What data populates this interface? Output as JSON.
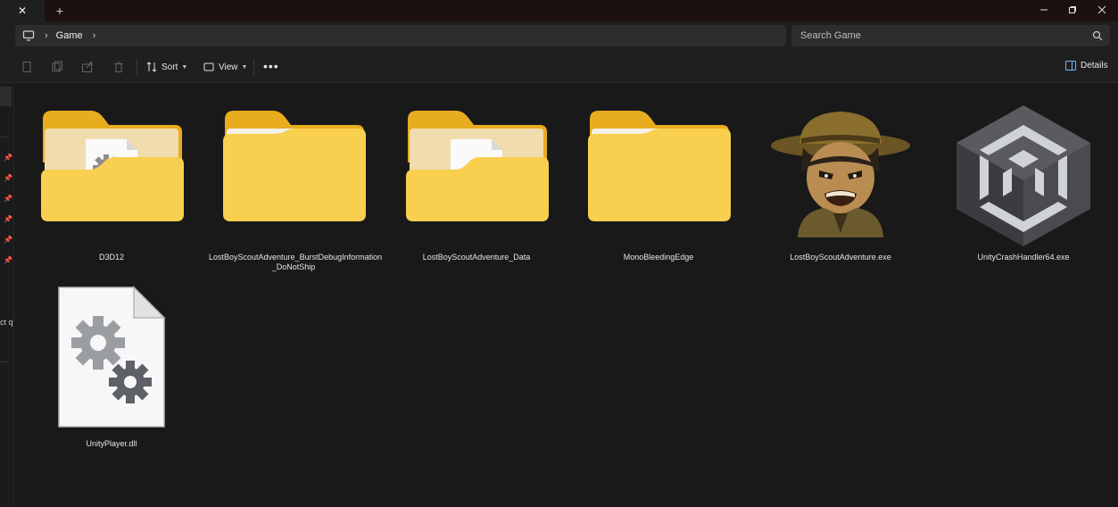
{
  "window": {
    "tab_close_icon": "close-icon",
    "new_tab_icon": "plus-icon",
    "controls": [
      "minimize-icon",
      "restore-icon",
      "close-icon"
    ]
  },
  "address": {
    "crumbs": [
      "Game"
    ],
    "search_placeholder": "Search Game"
  },
  "toolbar": {
    "sort_label": "Sort",
    "view_label": "View",
    "more_label": "•••",
    "details_label": "Details"
  },
  "nav": {
    "truncated_text": "ct q"
  },
  "items": [
    {
      "name": "D3D12",
      "kind": "folder-with-settings-file"
    },
    {
      "name": "LostBoyScoutAdventure_BurstDebugInformation_DoNotShip",
      "line1": "LostBoyScoutAdventure_BurstDebugInformation",
      "line2": "_DoNotShip",
      "kind": "folder"
    },
    {
      "name": "LostBoyScoutAdventure_Data",
      "kind": "folder-with-file"
    },
    {
      "name": "MonoBleedingEdge",
      "kind": "folder"
    },
    {
      "name": "LostBoyScoutAdventure.exe",
      "kind": "scout-app-icon"
    },
    {
      "name": "UnityCrashHandler64.exe",
      "kind": "unity-icon"
    },
    {
      "name": "UnityPlayer.dll",
      "kind": "dll-settings-file"
    }
  ],
  "colors": {
    "folder_front": "#f8cf4f",
    "folder_back": "#e8ad1f",
    "background": "#191919"
  }
}
